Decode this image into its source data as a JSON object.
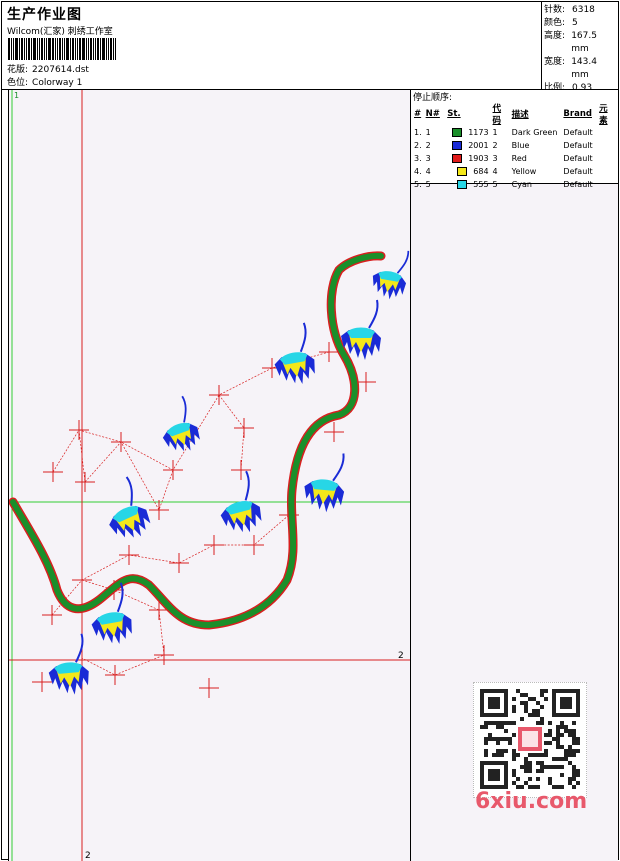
{
  "header": {
    "title": "生产作业图",
    "company": "Wilcom(汇家) 刺绣工作室",
    "design_label": "花版:",
    "design_value": "2207614.dst",
    "colorway_label": "色位:",
    "colorway_value": "Colorway 1"
  },
  "stats": [
    {
      "label": "针数:",
      "value": "6318"
    },
    {
      "label": "颜色:",
      "value": "5"
    },
    {
      "label": "高度:",
      "value": "167.5 mm"
    },
    {
      "label": "宽度:",
      "value": "143.4 mm"
    },
    {
      "label": "比例:",
      "value": "0.93"
    }
  ],
  "stop_sequence": {
    "title": "停止顺序:",
    "columns": [
      "#",
      "N#",
      "St.",
      "代码",
      "描述",
      "Brand",
      "元素"
    ],
    "rows": [
      {
        "idx": "1.",
        "n": "1",
        "color": "#1a8f2a",
        "stitches": "1173",
        "code": "1",
        "desc": "Dark Green",
        "brand": "Default"
      },
      {
        "idx": "2.",
        "n": "2",
        "color": "#1a2bd6",
        "stitches": "2001",
        "code": "2",
        "desc": "Blue",
        "brand": "Default"
      },
      {
        "idx": "3.",
        "n": "3",
        "color": "#e01b1b",
        "stitches": "1903",
        "code": "3",
        "desc": "Red",
        "brand": "Default"
      },
      {
        "idx": "4.",
        "n": "4",
        "color": "#f4e81a",
        "stitches": "684",
        "code": "4",
        "desc": "Yellow",
        "brand": "Default"
      },
      {
        "idx": "5.",
        "n": "5",
        "color": "#27d6e6",
        "stitches": "555",
        "code": "5",
        "desc": "Cyan",
        "brand": "Default"
      }
    ]
  },
  "canvas": {
    "axis_v_label_top": "1",
    "axis_v_label_bottom": "2",
    "axis_h_label": "2",
    "axis_green_label": "1"
  },
  "watermark": "6xiu.com",
  "colors": {
    "dark_green": "#1a8f2a",
    "blue": "#1a2bd6",
    "red": "#e01b1b",
    "yellow": "#f4e81a",
    "cyan": "#27d6e6",
    "guide_red": "#d81f1f",
    "guide_green": "#33cc33",
    "canvas_bg": "#f6f3f8"
  }
}
